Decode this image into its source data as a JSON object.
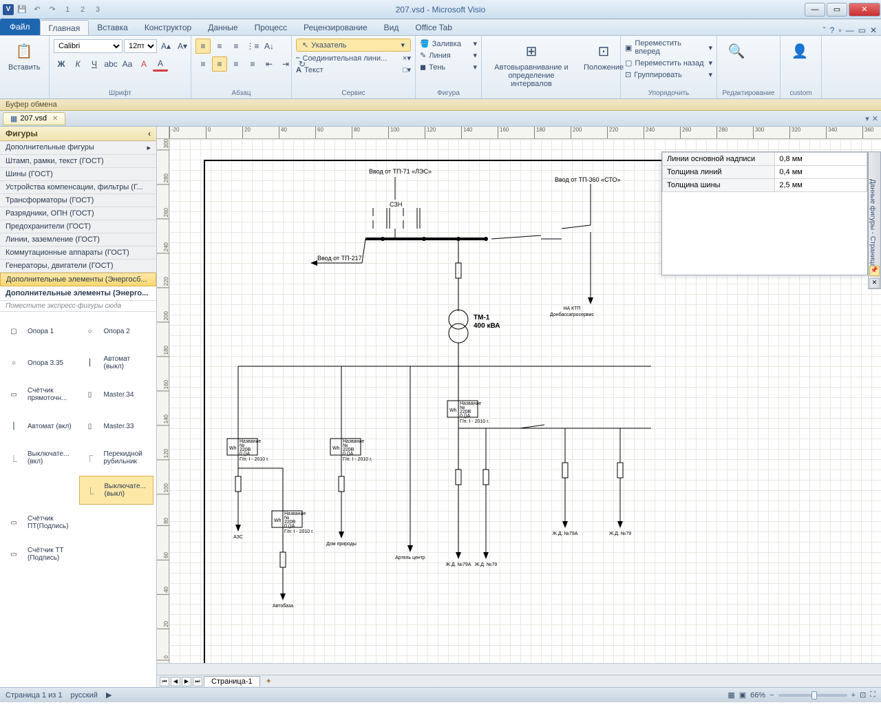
{
  "titlebar": {
    "title": "207.vsd - Microsoft Visio",
    "app_letter": "V"
  },
  "ribbon_tabs": {
    "file": "Файл",
    "home": "Главная",
    "insert": "Вставка",
    "designer": "Конструктор",
    "data": "Данные",
    "process": "Процесс",
    "review": "Рецензирование",
    "view": "Вид",
    "office_tab": "Office Tab"
  },
  "ribbon": {
    "clipboard": {
      "paste": "Вставить",
      "label": "Буфер обмена"
    },
    "font": {
      "name": "Calibri",
      "size": "12пт",
      "label": "Шрифт"
    },
    "paragraph": {
      "label": "Абзац"
    },
    "service": {
      "pointer": "Указатель",
      "connector": "Соединительная лини...",
      "text": "Текст",
      "label": "Сервис"
    },
    "shape": {
      "fill": "Заливка",
      "line": "Линия",
      "shadow": "Тень",
      "label": "Фигура"
    },
    "align": {
      "autoalign": "Автовыравнивание и определение интервалов",
      "position": "Положение"
    },
    "arrange": {
      "forward": "Переместить вперед",
      "backward": "Переместить назад",
      "group": "Группировать",
      "label": "Упорядочить"
    },
    "editing": {
      "label": "Редактирование"
    },
    "custom": {
      "label": "custom"
    }
  },
  "doc_tab": "207.vsd",
  "shapes_panel": {
    "header": "Фигуры",
    "more": "Дополнительные фигуры",
    "categories": [
      "Штамп, рамки, текст (ГОСТ)",
      "Шины (ГОСТ)",
      "Устройства компенсации, фильтры (Г...",
      "Трансформаторы (ГОСТ)",
      "Разрядники, ОПН (ГОСТ)",
      "Предохранители (ГОСТ)",
      "Линии, заземление (ГОСТ)",
      "Коммутационные аппараты (ГОСТ)",
      "Генераторы, двигатели (ГОСТ)",
      "Дополнительные элементы (Энергосб..."
    ],
    "current_title": "Дополнительные элементы (Энерго...",
    "hint": "Поместите экспресс-фигуры сюда",
    "shapes": [
      {
        "name": "Опора 1"
      },
      {
        "name": "Опора 2"
      },
      {
        "name": "Опора 3.35"
      },
      {
        "name": "Автомат (выкл)"
      },
      {
        "name": "Счётчик прямоточн..."
      },
      {
        "name": "Master.34"
      },
      {
        "name": "Автомат (вкл)"
      },
      {
        "name": "Master.33"
      },
      {
        "name": "Выключате... (вкл)"
      },
      {
        "name": "Перекидной рубильник"
      },
      {
        "name": ""
      },
      {
        "name": "Выключате... (выкл)",
        "sel": true
      },
      {
        "name": "Счётчик ПТ(Подпись)"
      },
      {
        "name": ""
      },
      {
        "name": "Счётчик ТТ (Подпись)"
      },
      {
        "name": ""
      }
    ]
  },
  "data_panel": {
    "tab_title": "Данные фигуры - Страница",
    "rows": [
      {
        "k": "Линии основной надписи",
        "v": "0,8 мм"
      },
      {
        "k": "Толщина линий",
        "v": "0,4 мм"
      },
      {
        "k": "Толщина шины",
        "v": "2,5 мм"
      }
    ]
  },
  "diagram": {
    "input_les": "Ввод от ТП-71 «ЛЭС»",
    "input_sto": "Ввод от ТП-360 «СТО»",
    "input_217": "Ввод от ТП-217",
    "szn": "СЗН",
    "tm1": "ТМ-1",
    "tm1_kva": "400 кВА",
    "ktp_line1": "НА КТП",
    "ktp_line2": "Донбассагросервис",
    "meter_name": "Название",
    "meter_no": "№",
    "meter_220": "220В",
    "meter_0a": "0   ()А",
    "meter_gp": "Г/п: I -   2010 г.",
    "wh": "Wh",
    "azs": "АЗС",
    "avtobaza": "Автобаза",
    "dom": "Дом природы",
    "artel": "Артель центр",
    "zhd79a": "Ж.Д. №79А",
    "zhd79": "Ж.Д. №79"
  },
  "page_tabs": {
    "page1": "Страница-1"
  },
  "statusbar": {
    "page": "Страница 1 из 1",
    "lang": "русский",
    "zoom": "66%"
  },
  "ruler_h": [
    "-20",
    "0",
    "20",
    "40",
    "60",
    "80",
    "100",
    "120",
    "140",
    "160",
    "180",
    "200",
    "220",
    "240",
    "260",
    "280",
    "300",
    "320",
    "340",
    "360"
  ],
  "ruler_v": [
    "300",
    "280",
    "260",
    "240",
    "220",
    "200",
    "180",
    "160",
    "140",
    "120",
    "100",
    "80",
    "60",
    "40",
    "20",
    "0"
  ]
}
